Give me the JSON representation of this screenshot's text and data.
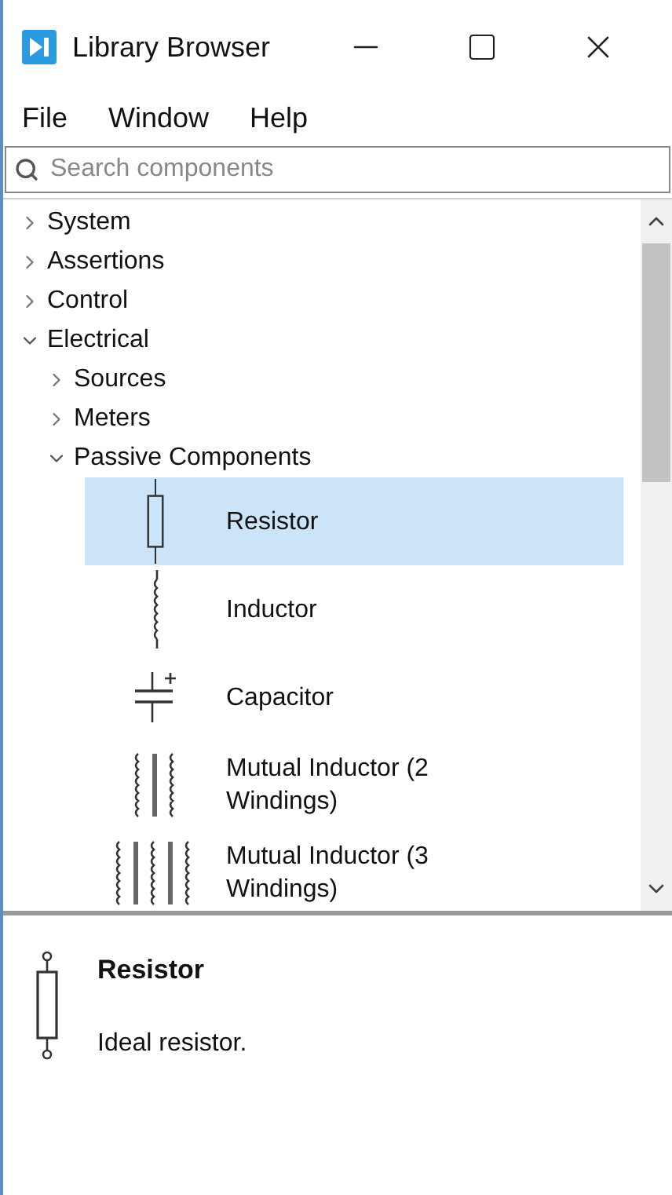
{
  "window": {
    "title": "Library Browser"
  },
  "menu": [
    "File",
    "Window",
    "Help"
  ],
  "search": {
    "placeholder": "Search components"
  },
  "tree": [
    {
      "label": "System",
      "expanded": false
    },
    {
      "label": "Assertions",
      "expanded": false
    },
    {
      "label": "Control",
      "expanded": false
    },
    {
      "label": "Electrical",
      "expanded": true,
      "children": [
        {
          "label": "Sources",
          "expanded": false
        },
        {
          "label": "Meters",
          "expanded": false
        },
        {
          "label": "Passive Components",
          "expanded": true,
          "components": [
            {
              "label": "Resistor",
              "kind": "resistor",
              "selected": true
            },
            {
              "label": "Inductor",
              "kind": "inductor",
              "selected": false
            },
            {
              "label": "Capacitor",
              "kind": "capacitor",
              "selected": false
            },
            {
              "label": "Mutual Inductor (2 Windings)",
              "kind": "mutual2",
              "selected": false
            },
            {
              "label": "Mutual Inductor (3 Windings)",
              "kind": "mutual3",
              "selected": false
            }
          ]
        }
      ]
    }
  ],
  "details": {
    "title": "Resistor",
    "description": "Ideal resistor.",
    "kind": "resistor"
  }
}
